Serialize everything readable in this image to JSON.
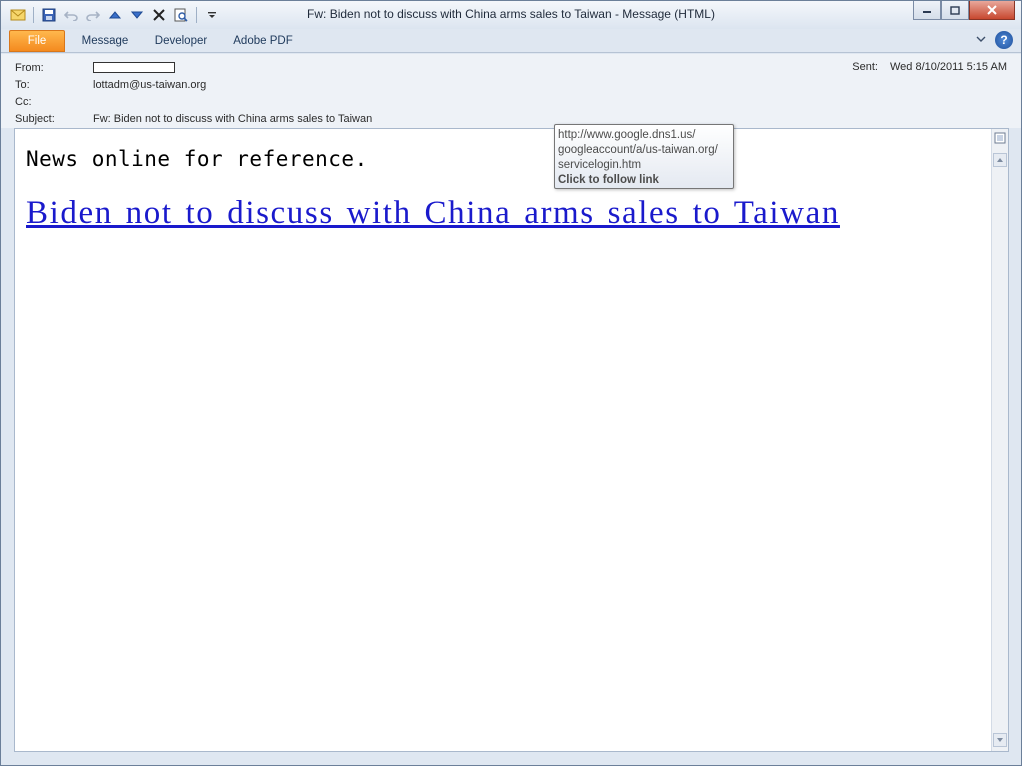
{
  "window": {
    "title": "Fw: Biden not to discuss with China arms sales to Taiwan  -  Message (HTML)"
  },
  "ribbon": {
    "tabs": [
      "File",
      "Message",
      "Developer",
      "Adobe PDF"
    ]
  },
  "header": {
    "from_label": "From:",
    "to_label": "To:",
    "to_value": "lottadm@us-taiwan.org",
    "cc_label": "Cc:",
    "subject_label": "Subject:",
    "subject_value": "Fw: Biden not to discuss with China arms sales to Taiwan",
    "sent_label": "Sent:",
    "sent_value": "Wed 8/10/2011 5:15 AM"
  },
  "body": {
    "intro": "News online for reference.",
    "link_text": "Biden not to discuss with China arms sales to Taiwan"
  },
  "tooltip": {
    "line1": "http://www.google.dns1.us/",
    "line2": "googleaccount/a/us-taiwan.org/",
    "line3": "servicelogin.htm",
    "action": "Click to follow link"
  },
  "colors": {
    "file_tab": "#f48a1f",
    "link": "#1a1acc",
    "close_button": "#c7482f"
  }
}
